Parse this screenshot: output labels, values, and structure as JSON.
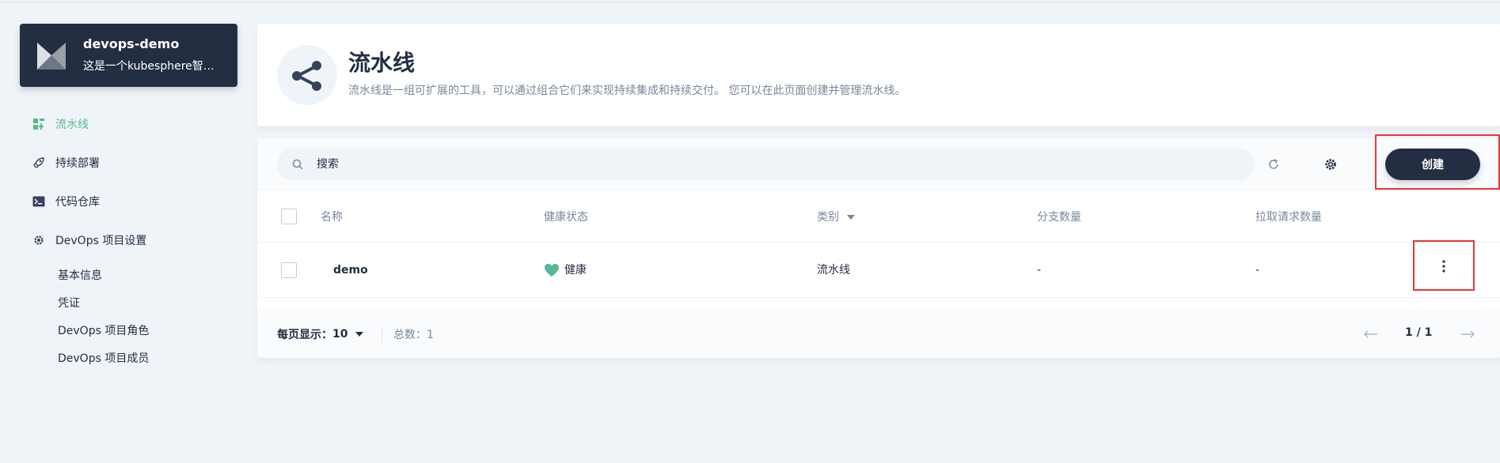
{
  "project": {
    "name": "devops-demo",
    "description": "这是一个kubesphere智…"
  },
  "sidebar": {
    "items": [
      {
        "label": "流水线",
        "icon": "pipeline-icon",
        "active": true
      },
      {
        "label": "持续部署",
        "icon": "rocket-icon",
        "active": false
      },
      {
        "label": "代码仓库",
        "icon": "terminal-icon",
        "active": false
      },
      {
        "label": "DevOps 项目设置",
        "icon": "gear-icon",
        "active": false
      }
    ],
    "sub_items": [
      {
        "label": "基本信息"
      },
      {
        "label": "凭证"
      },
      {
        "label": "DevOps 项目角色"
      },
      {
        "label": "DevOps 项目成员"
      }
    ]
  },
  "banner": {
    "title": "流水线",
    "description": "流水线是一组可扩展的工具，可以通过组合它们来实现持续集成和持续交付。 您可以在此页面创建并管理流水线。",
    "icon": "share-icon"
  },
  "toolbar": {
    "search_placeholder": "搜索",
    "create_label": "创建"
  },
  "table": {
    "columns": [
      "名称",
      "健康状态",
      "类别",
      "分支数量",
      "拉取请求数量"
    ],
    "rows": [
      {
        "name": "demo",
        "health": "健康",
        "category": "流水线",
        "branches": "-",
        "pull_requests": "-"
      }
    ]
  },
  "footer": {
    "page_size_label": "每页显示：",
    "page_size": "10",
    "total_label": "总数：1",
    "page_info": "1 / 1"
  },
  "colors": {
    "dark": "#242e42",
    "accent": "#55bc8a",
    "muted": "#79879c",
    "highlight": "#e53935"
  }
}
